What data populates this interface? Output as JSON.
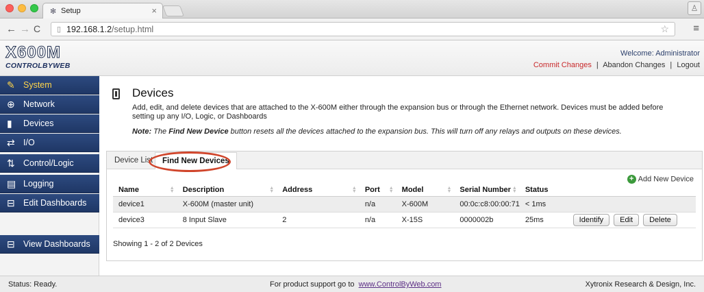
{
  "browser": {
    "tab_title": "Setup",
    "tab_close": "×",
    "url_host": "192.168.1.2",
    "url_path": "/setup.html",
    "nav_back": "←",
    "nav_forward": "→",
    "nav_reload": "C",
    "star_icon": "☆",
    "menu_icon": "≡"
  },
  "header": {
    "logo_main": "X600M",
    "logo_sub": "CONTROLBYWEB",
    "welcome": "Welcome: Administrator",
    "commit": "Commit Changes",
    "abandon": "Abandon Changes",
    "logout": "Logout",
    "separator": "|"
  },
  "sidebar": {
    "items": [
      {
        "label": "System",
        "icon": "wrench-icon",
        "glyph": "🔧"
      },
      {
        "label": "Network",
        "icon": "globe-icon",
        "glyph": "⊕"
      },
      {
        "label": "Devices",
        "icon": "device-icon",
        "glyph": "▮"
      },
      {
        "label": "I/O",
        "icon": "io-arrows-icon",
        "glyph": "⇄"
      },
      {
        "label": "Control/Logic",
        "icon": "logic-icon",
        "glyph": "⇅"
      },
      {
        "label": "Logging",
        "icon": "log-icon",
        "glyph": "▤"
      },
      {
        "label": "Edit Dashboards",
        "icon": "dashboard-edit-icon",
        "glyph": "⊟"
      },
      {
        "label": "View Dashboards",
        "icon": "dashboard-view-icon",
        "glyph": "⊟"
      }
    ]
  },
  "main": {
    "title": "Devices",
    "description": "Add, edit, and delete devices that are attached to the X-600M either through the expansion bus or through the Ethernet network. Devices must be added before setting up any I/O, Logic, or Dashboards",
    "note_label": "Note:",
    "note_pre": " The ",
    "note_bold": "Find New Device",
    "note_post": " button resets all the devices attached to the expansion bus. This will turn off any relays and outputs on these devices.",
    "tabs": [
      "Device List",
      "Find New Devices"
    ],
    "add_new": "Add New Device",
    "columns": [
      "Name",
      "Description",
      "Address",
      "Port",
      "Model",
      "Serial Number",
      "Status"
    ],
    "rows": [
      {
        "name": "device1",
        "description": "X-600M (master unit)",
        "address": "",
        "port": "n/a",
        "model": "X-600M",
        "serial": "00:0c:c8:00:00:71",
        "status": "< 1ms"
      },
      {
        "name": "device3",
        "description": "8 Input Slave",
        "address": "2",
        "port": "n/a",
        "model": "X-15S",
        "serial": "0000002b",
        "status": "25ms"
      }
    ],
    "row_actions": [
      "Identify",
      "Edit",
      "Delete"
    ],
    "showing": "Showing 1 - 2 of 2 Devices"
  },
  "statusbar": {
    "status": "Status:  Ready.",
    "support_text": "For product support go to",
    "support_link": "www.ControlByWeb.com",
    "company": "Xytronix Research & Design, Inc."
  },
  "colors": {
    "sidebar_bg": "#1f3766",
    "active_item": "#ffd54a",
    "commit_link": "#c8282a",
    "status_ok": "#2f8a2f",
    "highlight_oval": "#d0452b"
  }
}
